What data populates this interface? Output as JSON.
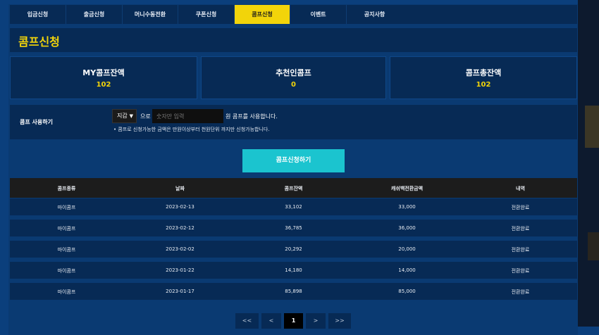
{
  "tabs": [
    {
      "label": "입금신청"
    },
    {
      "label": "출금신청"
    },
    {
      "label": "머니수동전환"
    },
    {
      "label": "쿠폰신청"
    },
    {
      "label": "콤프신청"
    },
    {
      "label": "이벤트"
    },
    {
      "label": "공지사항"
    }
  ],
  "page_title": "콤프신청",
  "stats": [
    {
      "label": "MY콤프잔액",
      "value": "102"
    },
    {
      "label": "추천인콤프",
      "value": "0"
    },
    {
      "label": "콤프총잔액",
      "value": "102"
    }
  ],
  "comp_use": {
    "label": "콤프 사용하기",
    "select_value": "지갑",
    "particle": "으로",
    "input_placeholder": "숫자만 입력",
    "suffix": "원 콤프를 사용합니다.",
    "note": "• 콤프로 신청가능한 금액은 만원이상부터 천원단위 까지만 신청가능합니다."
  },
  "apply_button": "콤프신청하기",
  "table": {
    "headers": [
      "콤프종류",
      "날짜",
      "콤프잔액",
      "캐쉬백전환금액",
      "내역"
    ],
    "rows": [
      [
        "마이콤프",
        "2023-02-13",
        "33,102",
        "33,000",
        "전환완료"
      ],
      [
        "마이콤프",
        "2023-02-12",
        "36,785",
        "36,000",
        "전환완료"
      ],
      [
        "마이콤프",
        "2023-02-02",
        "20,292",
        "20,000",
        "전환완료"
      ],
      [
        "마이콤프",
        "2023-01-22",
        "14,180",
        "14,000",
        "전환완료"
      ],
      [
        "마이콤프",
        "2023-01-17",
        "85,898",
        "85,000",
        "전환완료"
      ]
    ]
  },
  "pagination": {
    "first": "<<",
    "prev": "<",
    "current": "1",
    "next": ">",
    "last": ">>"
  },
  "colors": {
    "accent": "#f2d40a",
    "button": "#1bc4cf",
    "panel": "#072a55",
    "background": "#0b3f7c"
  }
}
